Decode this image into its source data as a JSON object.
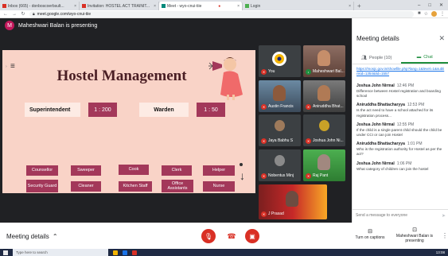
{
  "browser": {
    "tabs": [
      {
        "label": "Inbox (665) - donboscoerbsult...",
        "active": false
      },
      {
        "label": "Invitation: HOSTEL ACT TRAINIT...",
        "active": false
      },
      {
        "label": "Meet - wyo-cnui-tiie",
        "active": true
      },
      {
        "label": "Login",
        "active": false
      }
    ],
    "url": "meet.google.com/wyo-cnui-tiie"
  },
  "meet": {
    "presenter_initial": "M",
    "presenter_text": "Maheshwari Balan is presenting"
  },
  "slide": {
    "title": "Hostel Management",
    "pills": [
      {
        "label": "Superintendent",
        "style": "light"
      },
      {
        "label": "1 : 200",
        "style": "dark"
      },
      {
        "label": "Warden",
        "style": "light"
      },
      {
        "label": "1 : 50",
        "style": "dark"
      }
    ],
    "buttons": [
      "Counsellor",
      "Sweeper",
      "Cook",
      "Clerk",
      "Helper",
      "Security Guard",
      "Cleaner",
      "Kitchen Staff",
      "Office Assistants",
      "Nurse"
    ]
  },
  "participants": [
    {
      "name": "You"
    },
    {
      "name": "Maheshwari Bal..."
    },
    {
      "name": "Austin Francis"
    },
    {
      "name": "Aniruddha Bhat..."
    },
    {
      "name": "Jaya Babhu S"
    },
    {
      "name": "Joshua John Ni..."
    },
    {
      "name": "Nobentus Minj"
    },
    {
      "name": "Raj Pant"
    },
    {
      "name": "J Prasad"
    }
  ],
  "toolbar": {
    "meeting_details": "Meeting details",
    "captions": "Turn on captions",
    "presenting": "Maheshwari Balan is presenting"
  },
  "panel": {
    "title": "Meeting details",
    "tabs": {
      "people": "People (10)",
      "chat": "Chat"
    },
    "link": "https://mosjc.gov.in/showfile.php?lang=1&level=1&sublinkid=1354&lid=1557",
    "messages": [
      {
        "author": "Joshua John Nirmal",
        "time": "12:46 PM",
        "text": "Difference between Hostel registration and boarding school"
      },
      {
        "author": "Aniruddha Bhattacharyya",
        "time": "12:53 PM",
        "text": "Is the act need to have a school attached for its registration process..."
      },
      {
        "author": "Joshua John Nirmal",
        "time": "12:55 PM",
        "text": "If the child is a single parent child should the child be under CCI or can join Hostel"
      },
      {
        "author": "Aniruddha Bhattacharyya",
        "time": "1:01 PM",
        "text": "Who is the registration authority for Hostel as per the act?"
      },
      {
        "author": "Joshua John Nirmal",
        "time": "1:06 PM",
        "text": "What category of children can join the hostel"
      }
    ],
    "input_placeholder": "Send a message to everyone"
  },
  "taskbar": {
    "search_placeholder": "Type here to search",
    "clock": "13:08"
  },
  "colors": {
    "slide_bg": "#f9d3c7",
    "accent_button": "#a3385a",
    "title_color": "#4a1e24",
    "mute_red": "#d93025",
    "chat_green": "#1e8e3e"
  }
}
